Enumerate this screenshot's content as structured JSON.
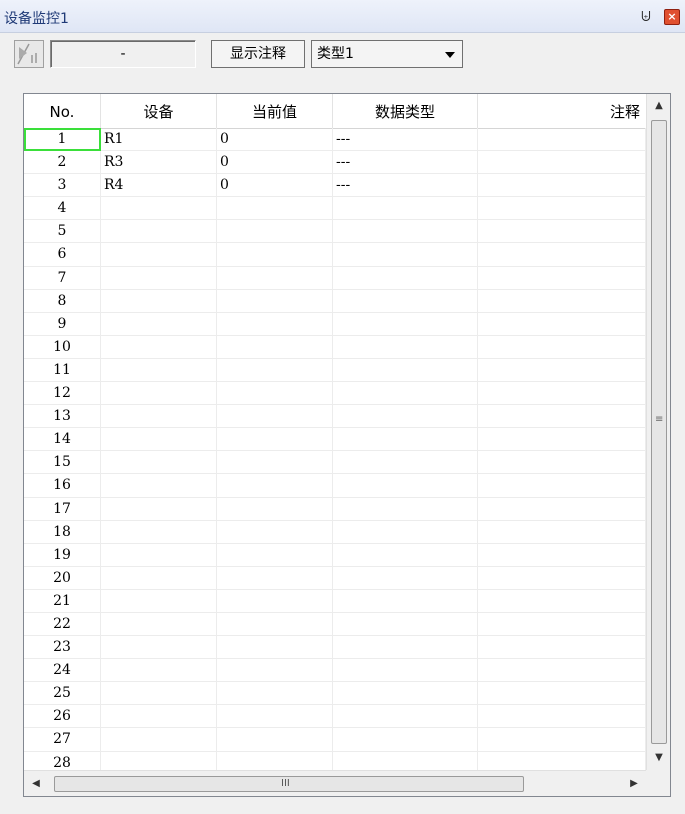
{
  "window": {
    "title": "设备监控1",
    "pin_icon": "pin-icon",
    "close_icon": "close-icon"
  },
  "toolbar": {
    "value_field": "-",
    "show_comment_label": "显示注释",
    "type_select_value": "类型1"
  },
  "table": {
    "columns": [
      "No.",
      "设备",
      "当前值",
      "数据类型",
      "注释"
    ],
    "rows": [
      {
        "no": "1",
        "device": "R1",
        "value": "0",
        "type": "---",
        "note": ""
      },
      {
        "no": "2",
        "device": "R3",
        "value": "0",
        "type": "---",
        "note": ""
      },
      {
        "no": "3",
        "device": "R4",
        "value": "0",
        "type": "---",
        "note": ""
      },
      {
        "no": "4",
        "device": "",
        "value": "",
        "type": "",
        "note": ""
      },
      {
        "no": "5",
        "device": "",
        "value": "",
        "type": "",
        "note": ""
      },
      {
        "no": "6",
        "device": "",
        "value": "",
        "type": "",
        "note": ""
      },
      {
        "no": "7",
        "device": "",
        "value": "",
        "type": "",
        "note": ""
      },
      {
        "no": "8",
        "device": "",
        "value": "",
        "type": "",
        "note": ""
      },
      {
        "no": "9",
        "device": "",
        "value": "",
        "type": "",
        "note": ""
      },
      {
        "no": "10",
        "device": "",
        "value": "",
        "type": "",
        "note": ""
      },
      {
        "no": "11",
        "device": "",
        "value": "",
        "type": "",
        "note": ""
      },
      {
        "no": "12",
        "device": "",
        "value": "",
        "type": "",
        "note": ""
      },
      {
        "no": "13",
        "device": "",
        "value": "",
        "type": "",
        "note": ""
      },
      {
        "no": "14",
        "device": "",
        "value": "",
        "type": "",
        "note": ""
      },
      {
        "no": "15",
        "device": "",
        "value": "",
        "type": "",
        "note": ""
      },
      {
        "no": "16",
        "device": "",
        "value": "",
        "type": "",
        "note": ""
      },
      {
        "no": "17",
        "device": "",
        "value": "",
        "type": "",
        "note": ""
      },
      {
        "no": "18",
        "device": "",
        "value": "",
        "type": "",
        "note": ""
      },
      {
        "no": "19",
        "device": "",
        "value": "",
        "type": "",
        "note": ""
      },
      {
        "no": "20",
        "device": "",
        "value": "",
        "type": "",
        "note": ""
      },
      {
        "no": "21",
        "device": "",
        "value": "",
        "type": "",
        "note": ""
      },
      {
        "no": "22",
        "device": "",
        "value": "",
        "type": "",
        "note": ""
      },
      {
        "no": "23",
        "device": "",
        "value": "",
        "type": "",
        "note": ""
      },
      {
        "no": "24",
        "device": "",
        "value": "",
        "type": "",
        "note": ""
      },
      {
        "no": "25",
        "device": "",
        "value": "",
        "type": "",
        "note": ""
      },
      {
        "no": "26",
        "device": "",
        "value": "",
        "type": "",
        "note": ""
      },
      {
        "no": "27",
        "device": "",
        "value": "",
        "type": "",
        "note": ""
      },
      {
        "no": "28",
        "device": "",
        "value": "",
        "type": "",
        "note": ""
      }
    ]
  },
  "scrollbars": {
    "h_thumb_grip": "III",
    "v_thumb_grip": "≡"
  },
  "colors": {
    "selection_outline": "#3adf3a",
    "title_text": "#1f3a77",
    "close_button": "#e05030"
  }
}
